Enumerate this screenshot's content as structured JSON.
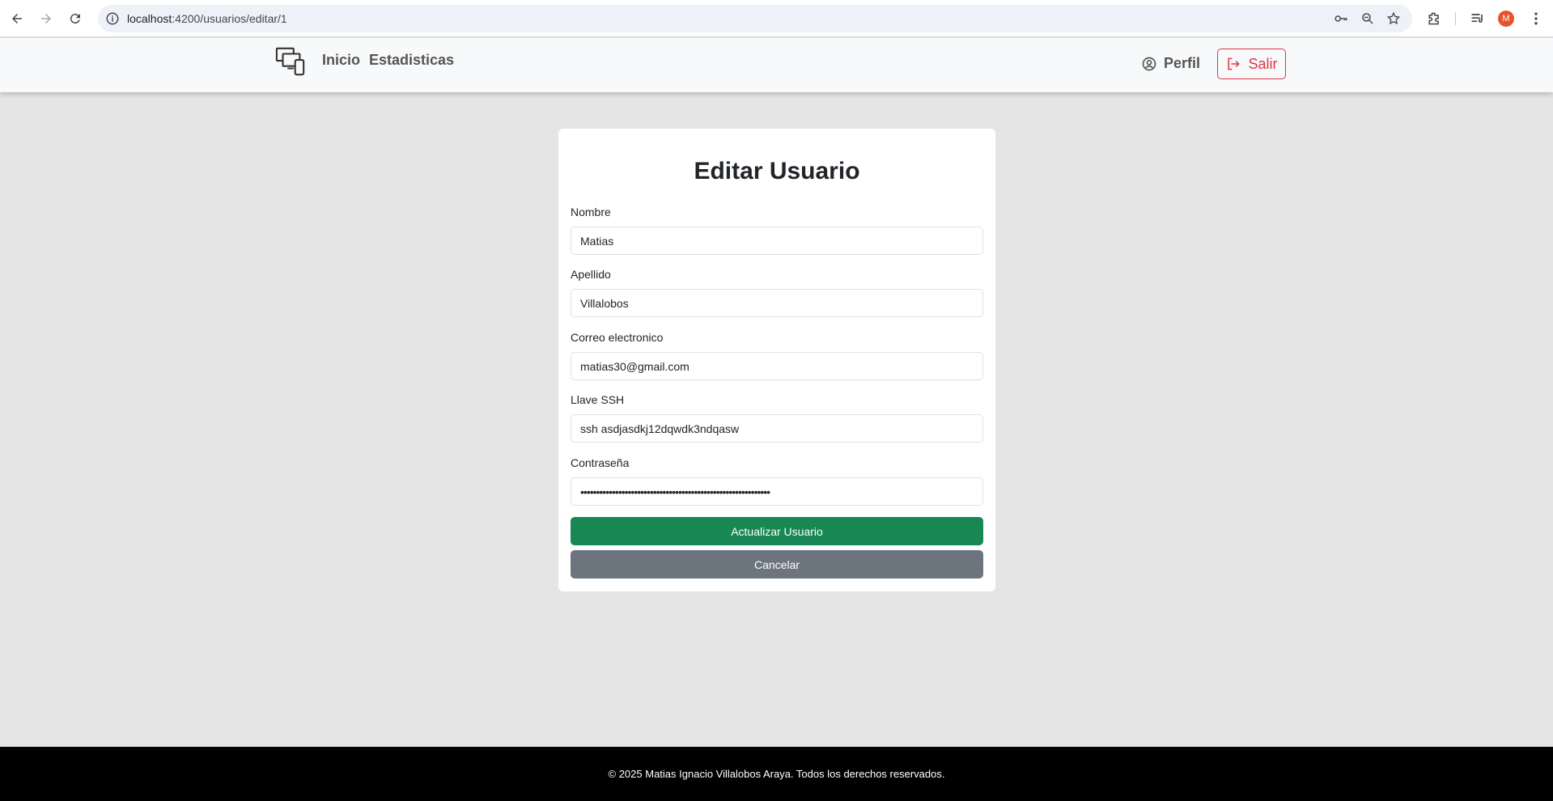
{
  "browser": {
    "url_host": "localhost",
    "url_path": ":4200/usuarios/editar/1",
    "avatar_letter": "M"
  },
  "navbar": {
    "brand_icon": "devices-icon",
    "links": [
      "Inicio",
      "Estadisticas"
    ],
    "profile_label": "Perfil",
    "logout_label": "Salir"
  },
  "form": {
    "title": "Editar Usuario",
    "fields": [
      {
        "label": "Nombre",
        "value": "Matias"
      },
      {
        "label": "Apellido",
        "value": "Villalobos"
      },
      {
        "label": "Correo electronico",
        "value": "matias30@gmail.com"
      },
      {
        "label": "Llave SSH",
        "value": "ssh asdjasdkj12dqwdk3ndqasw"
      },
      {
        "label": "Contraseña",
        "value": "••••••••••••••••••••••••••••••••••••••••••••••••••••••••••••"
      }
    ],
    "submit_label": "Actualizar Usuario",
    "cancel_label": "Cancelar"
  },
  "footer": {
    "text": "© 2025 Matias Ignacio Villalobos Araya. Todos los derechos reservados."
  },
  "colors": {
    "success": "#198754",
    "secondary": "#6c757d",
    "danger": "#dc3545",
    "avatar": "#e8532b"
  }
}
